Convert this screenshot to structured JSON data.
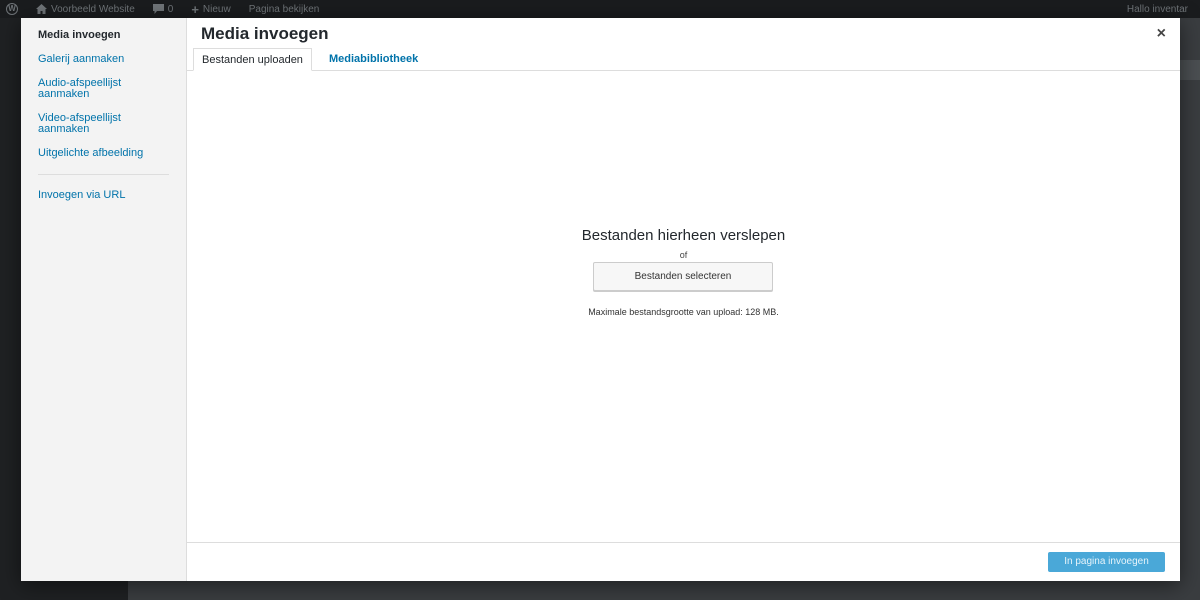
{
  "adminbar": {
    "site_name": "Voorbeeld Website",
    "comments_count": "0",
    "new_label": "Nieuw",
    "view_page_label": "Pagina bekijken",
    "greeting": "Hallo inventar"
  },
  "sidebar": {
    "items": [
      {
        "label": "Media invoegen"
      },
      {
        "label": "Galerij aanmaken"
      },
      {
        "label": "Audio-afspeellijst aanmaken"
      },
      {
        "label": "Video-afspeellijst aanmaken"
      },
      {
        "label": "Uitgelichte afbeelding"
      },
      {
        "label": "Invoegen via URL"
      }
    ]
  },
  "modal": {
    "title": "Media invoegen",
    "close": "×",
    "tabs": [
      {
        "label": "Bestanden uploaden"
      },
      {
        "label": "Mediabibliotheek"
      }
    ],
    "upload": {
      "drop_title": "Bestanden hierheen verslepen",
      "or": "of",
      "select_button": "Bestanden selecteren",
      "max_size": "Maximale bestandsgrootte van upload: 128 MB."
    },
    "insert_button": "In pagina invoegen"
  },
  "colors": {
    "link": "#0073aa",
    "primary_button": "#4aa8d8"
  }
}
